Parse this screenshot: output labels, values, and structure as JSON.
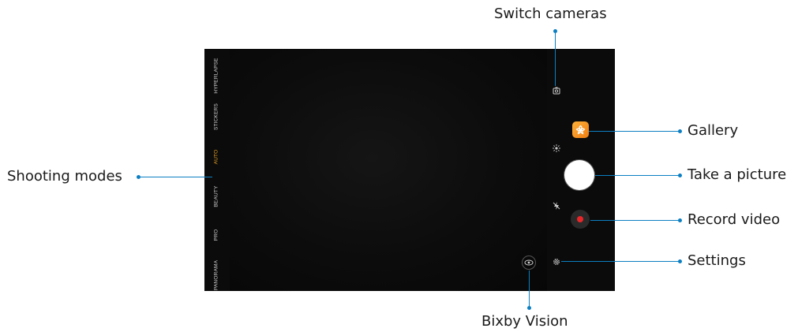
{
  "callouts": {
    "switch_cameras": "Switch cameras",
    "gallery": "Gallery",
    "take_picture": "Take a picture",
    "record_video": "Record video",
    "settings": "Settings",
    "shooting_modes": "Shooting modes",
    "bixby_vision": "Bixby Vision"
  },
  "modes": [
    "HYPERLAPSE",
    "STICKERS",
    "AUTO",
    "BEAUTY",
    "PRO",
    "PANORAMA"
  ],
  "active_mode": "AUTO",
  "colors": {
    "callout_line": "#0c7fc2",
    "active_mode": "#e9a125",
    "record_dot": "#e8262a",
    "gallery_icon": "#f59a22"
  },
  "icons": {
    "switch_cameras": "switch-camera-icon",
    "flash": "flash-off-icon",
    "effects": "effects-icon",
    "bixby": "bixby-vision-icon",
    "settings": "gear-icon"
  }
}
